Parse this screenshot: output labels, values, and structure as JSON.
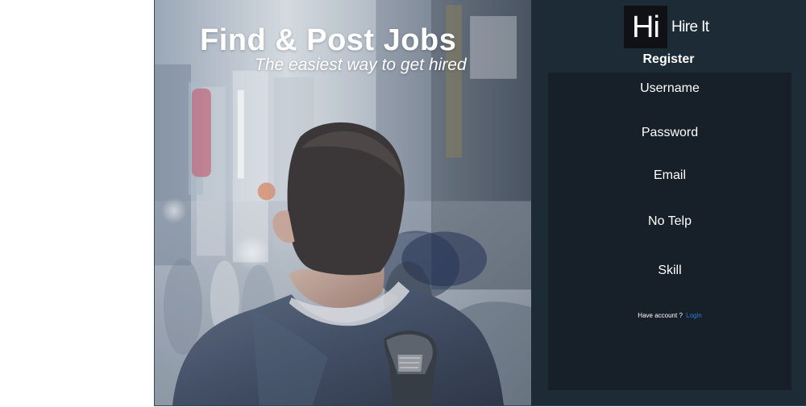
{
  "hero": {
    "title": "Find & Post Jobs",
    "subtitle": "The easiest way to get hired"
  },
  "brand": {
    "mark": "Hi",
    "name": "Hire It"
  },
  "register": {
    "title": "Register",
    "fields": {
      "username": "Username",
      "password": "Password",
      "email": "Email",
      "phone": "No Telp",
      "skill": "Skill"
    },
    "account_prompt": "Have account ?",
    "login_label": "Login"
  },
  "colors": {
    "panel": "#1d2b37",
    "form_card": "#172028",
    "brand_mark": "#0f1114",
    "link": "#2b79d8"
  },
  "icons": {
    "background_photo": "man-city-street-photo"
  }
}
